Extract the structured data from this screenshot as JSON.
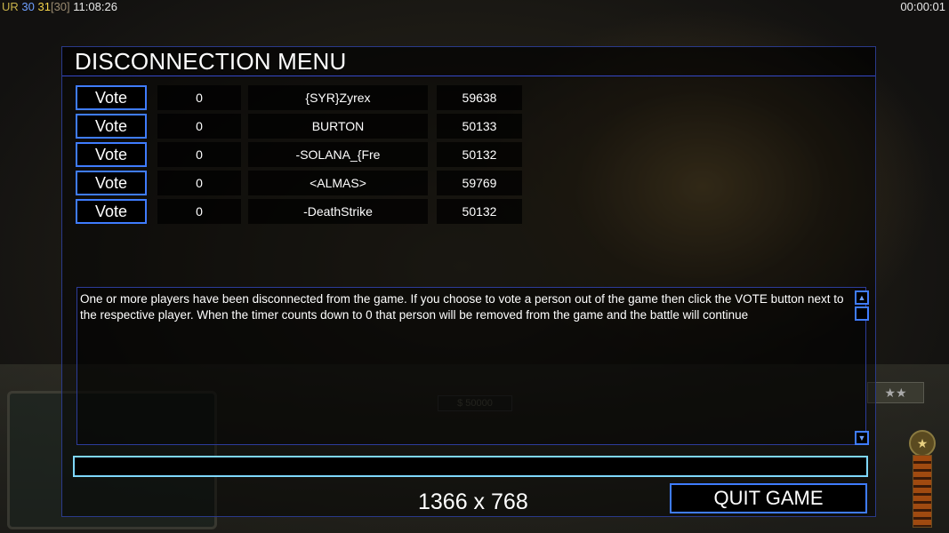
{
  "hud": {
    "left_prefix": "UR",
    "left_n1": "30",
    "left_n2": "31",
    "left_n3": "[30]",
    "clock": "11:08:26",
    "right_timer": "00:00:01"
  },
  "background": {
    "money": "$ 50000",
    "rank_icon": "star-rank-icon",
    "stars": "★★"
  },
  "dialog": {
    "title": "DISCONNECTION MENU",
    "vote_label": "Vote",
    "players": [
      {
        "timer": "0",
        "name": "{SYR}Zyrex",
        "id": "59638"
      },
      {
        "timer": "0",
        "name": "BURTON",
        "id": "50133"
      },
      {
        "timer": "0",
        "name": "-SOLANA_{Fre",
        "id": "50132"
      },
      {
        "timer": "0",
        "name": "<ALMAS>",
        "id": "59769"
      },
      {
        "timer": "0",
        "name": "-DeathStrike",
        "id": "50132"
      }
    ],
    "message": "One or more players have been disconnected from the game. If you choose to vote a person out of the game then click the VOTE button next to the respective player. When the timer counts down to 0 that person will be removed from the game and the battle will continue",
    "chat_value": "",
    "quit_label": "QUIT GAME"
  },
  "overlay": {
    "resolution": "1366 x 768"
  },
  "colors": {
    "button_border": "#3f7cff",
    "input_border": "#7fd8ff",
    "header_line": "#3548c8"
  }
}
